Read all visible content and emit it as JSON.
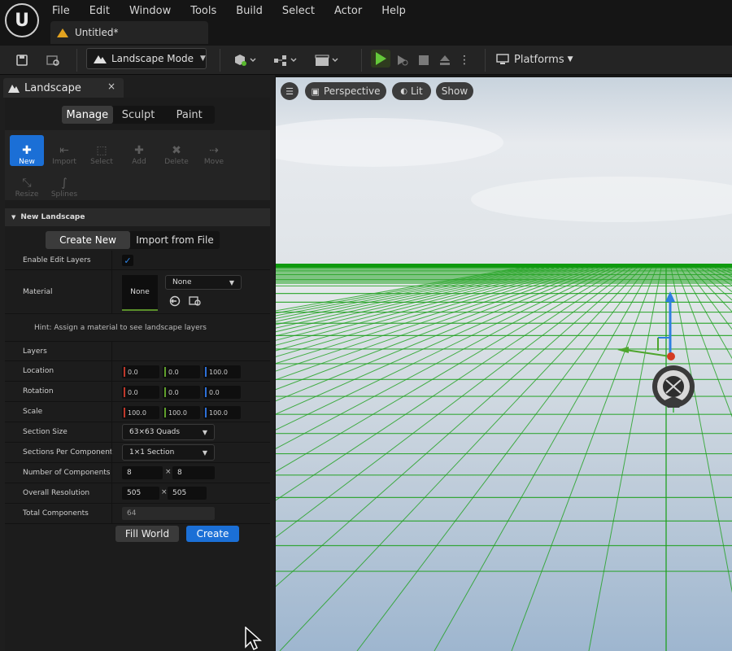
{
  "app": {
    "logo_text": "U",
    "document_tab": "Untitled*"
  },
  "menu": [
    "File",
    "Edit",
    "Window",
    "Tools",
    "Build",
    "Select",
    "Actor",
    "Help"
  ],
  "toolbar": {
    "mode_label": "Landscape Mode",
    "platforms_label": "Platforms"
  },
  "panel": {
    "tab_label": "Landscape",
    "close_glyph": "×",
    "modes": [
      "Manage",
      "Sculpt",
      "Paint"
    ],
    "tools": [
      {
        "label": "New",
        "icon": "✚"
      },
      {
        "label": "Import",
        "icon": "⇤"
      },
      {
        "label": "Select",
        "icon": "⬚"
      },
      {
        "label": "Add",
        "icon": "✚"
      },
      {
        "label": "Delete",
        "icon": "✖"
      },
      {
        "label": "Move",
        "icon": "⇢"
      },
      {
        "label": "Resize",
        "icon": "⤡"
      },
      {
        "label": "Splines",
        "icon": "∫"
      }
    ],
    "section_title": "New Landscape",
    "create_modes": [
      "Create New",
      "Import from File"
    ],
    "enable_edit_layers_label": "Enable Edit Layers",
    "material_label": "Material",
    "material_thumb": "None",
    "material_dropdown": "None",
    "hint": "Hint: Assign a material to see landscape layers",
    "layers_label": "Layers",
    "location": {
      "label": "Location",
      "x": "0.0",
      "y": "0.0",
      "z": "100.0"
    },
    "rotation": {
      "label": "Rotation",
      "x": "0.0",
      "y": "0.0",
      "z": "0.0"
    },
    "scale": {
      "label": "Scale",
      "x": "100.0",
      "y": "100.0",
      "z": "100.0"
    },
    "section_size": {
      "label": "Section Size",
      "value": "63×63 Quads"
    },
    "sections_per_component": {
      "label": "Sections Per Component",
      "value": "1×1 Section"
    },
    "number_of_components": {
      "label": "Number of Components",
      "x": "8",
      "y": "8"
    },
    "overall_resolution": {
      "label": "Overall Resolution",
      "x": "505",
      "y": "505"
    },
    "total_components": {
      "label": "Total Components",
      "value": "64"
    },
    "fill_world_label": "Fill World",
    "create_label": "Create"
  },
  "viewport": {
    "perspective_label": "Perspective",
    "lit_label": "Lit",
    "show_label": "Show"
  },
  "colors": {
    "accent": "#1b6fd6",
    "grid": "#1fa11f",
    "horizon": "#0f9a0f"
  }
}
